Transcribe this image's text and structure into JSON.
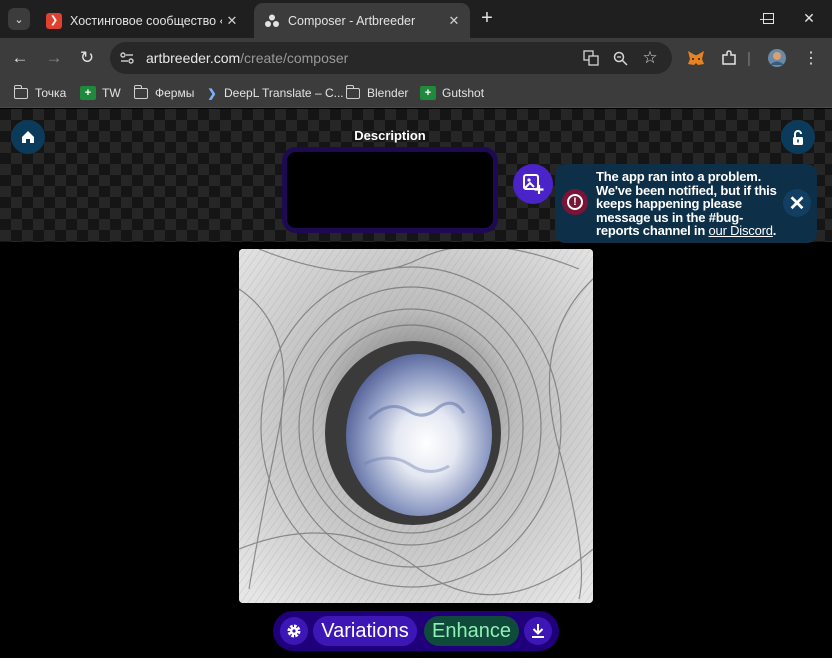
{
  "browser": {
    "tabs": [
      {
        "title": "Хостинговое сообщество «Tim",
        "active": false
      },
      {
        "title": "Composer - Artbreeder",
        "active": true
      }
    ],
    "url": {
      "domain": "artbreeder.com",
      "path": "/create/composer"
    },
    "bookmarks": [
      {
        "label": "Точка",
        "icon": "folder-icon"
      },
      {
        "label": "TW",
        "icon": "green-plus-icon"
      },
      {
        "label": "Фермы",
        "icon": "folder-icon"
      },
      {
        "label": "DeepL Translate – C...",
        "icon": "deepl-icon"
      },
      {
        "label": "Blender",
        "icon": "folder-icon"
      },
      {
        "label": "Gutshot",
        "icon": "green-plus-icon"
      }
    ]
  },
  "page": {
    "description_label": "Description",
    "description_value": "",
    "error": {
      "message": "The app ran into a problem. We've been notified, but if this keeps happening please message us in the #bug-reports channel in",
      "link_text": "our Discord",
      "suffix": "."
    },
    "actions": {
      "variations_label": "Variations",
      "enhance_label": "Enhance"
    }
  },
  "colors": {
    "accent_purple": "#4a23c9",
    "error_bg": "#0e2f48",
    "enhance_text": "#8ff0b4"
  }
}
